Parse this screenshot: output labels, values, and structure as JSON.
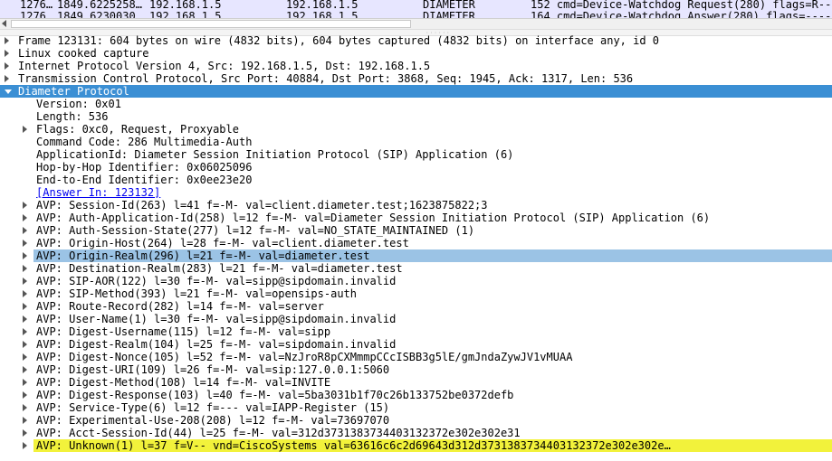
{
  "packet_list": {
    "rows": [
      {
        "no": "1276…",
        "time": "1849.6225258…",
        "src": "192.168.1.5",
        "dst": "192.168.1.5",
        "proto": "DIAMETER",
        "info": "152 cmd=Device-Watchdog Request(280) flags=R---"
      },
      {
        "no": "1276…",
        "time": "1849.6230030…",
        "src": "192.168.1.5",
        "dst": "192.168.1.5",
        "proto": "DIAMETER",
        "info": "164 cmd=Device-Watchdog Answer(280) flags=----"
      }
    ]
  },
  "tree": {
    "rows": [
      {
        "text": "Frame 123131: 604 bytes on wire (4832 bits), 604 bytes captured (4832 bits) on interface any, id 0"
      },
      {
        "text": "Linux cooked capture"
      },
      {
        "text": "Internet Protocol Version 4, Src: 192.168.1.5, Dst: 192.168.1.5"
      },
      {
        "text": "Transmission Control Protocol, Src Port: 40884, Dst Port: 3868, Seq: 1945, Ack: 1317, Len: 536"
      },
      {
        "text": "Diameter Protocol"
      },
      {
        "text": "Version: 0x01"
      },
      {
        "text": "Length: 536"
      },
      {
        "text": "Flags: 0xc0, Request, Proxyable"
      },
      {
        "text": "Command Code: 286 Multimedia-Auth"
      },
      {
        "text": "ApplicationId: Diameter Session Initiation Protocol (SIP) Application (6)"
      },
      {
        "text": "Hop-by-Hop Identifier: 0x06025096"
      },
      {
        "text": "End-to-End Identifier: 0x0ee23e20"
      },
      {
        "text": "[Answer In: 123132]"
      },
      {
        "text": "AVP: Session-Id(263) l=41 f=-M- val=client.diameter.test;1623875822;3"
      },
      {
        "text": "AVP: Auth-Application-Id(258) l=12 f=-M- val=Diameter Session Initiation Protocol (SIP) Application (6)"
      },
      {
        "text": "AVP: Auth-Session-State(277) l=12 f=-M- val=NO_STATE_MAINTAINED (1)"
      },
      {
        "text": "AVP: Origin-Host(264) l=28 f=-M- val=client.diameter.test"
      },
      {
        "text": "AVP: Origin-Realm(296) l=21 f=-M- val=diameter.test"
      },
      {
        "text": "AVP: Destination-Realm(283) l=21 f=-M- val=diameter.test"
      },
      {
        "text": "AVP: SIP-AOR(122) l=30 f=-M- val=sipp@sipdomain.invalid"
      },
      {
        "text": "AVP: SIP-Method(393) l=21 f=-M- val=opensips-auth"
      },
      {
        "text": "AVP: Route-Record(282) l=14 f=-M- val=server"
      },
      {
        "text": "AVP: User-Name(1) l=30 f=-M- val=sipp@sipdomain.invalid"
      },
      {
        "text": "AVP: Digest-Username(115) l=12 f=-M- val=sipp"
      },
      {
        "text": "AVP: Digest-Realm(104) l=25 f=-M- val=sipdomain.invalid"
      },
      {
        "text": "AVP: Digest-Nonce(105) l=52 f=-M- val=NzJroR8pCXMmmpCCcISBB3g5lE/gmJndaZywJV1vMUAA"
      },
      {
        "text": "AVP: Digest-URI(109) l=26 f=-M- val=sip:127.0.0.1:5060"
      },
      {
        "text": "AVP: Digest-Method(108) l=14 f=-M- val=INVITE"
      },
      {
        "text": "AVP: Digest-Response(103) l=40 f=-M- val=5ba3031b1f70c26b133752be0372defb"
      },
      {
        "text": "AVP: Service-Type(6) l=12 f=--- val=IAPP-Register (15)"
      },
      {
        "text": "AVP: Experimental-Use-208(208) l=12 f=-M- val=73697070"
      },
      {
        "text": "AVP: Acct-Session-Id(44) l=25 f=-M- val=312d3731383734403132372e302e302e31"
      },
      {
        "text": "AVP: Unknown(1) l=37 f=V-- vnd=CiscoSystems val=63616c6c2d69643d312d3731383734403132372e302e302e…"
      }
    ]
  },
  "colors": {
    "packet_list_bg": "#e7e6ff",
    "protocol_highlight": "#3b8fd4",
    "selected_row": "#9bc3e5",
    "warning_row": "#f2f23b",
    "link": "#0000ee"
  }
}
